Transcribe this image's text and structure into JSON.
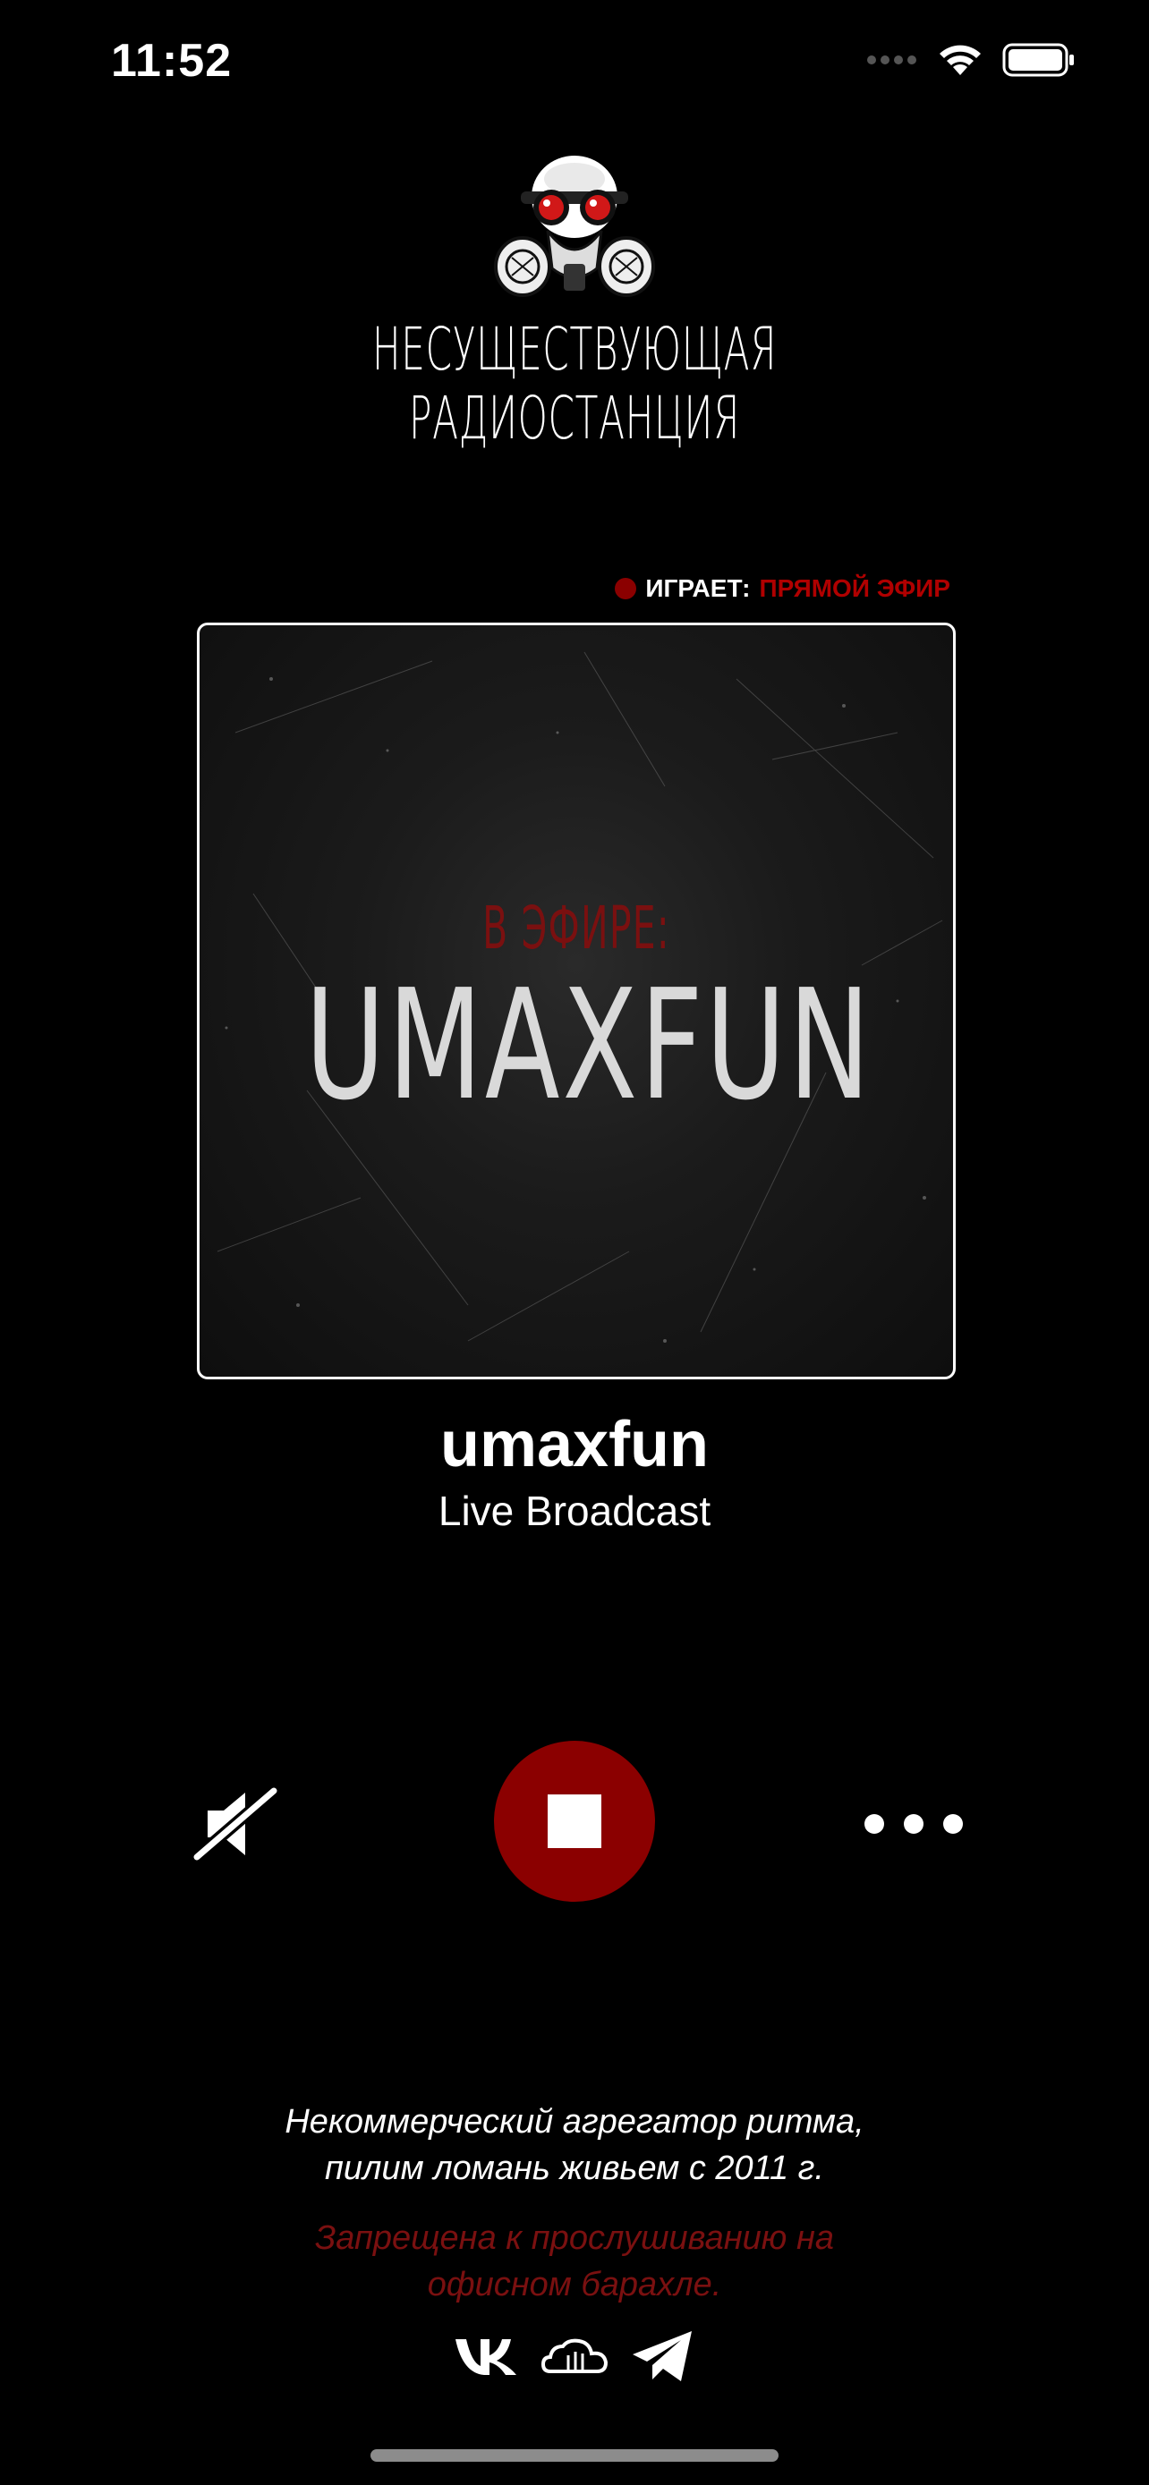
{
  "status_bar": {
    "time": "11:52"
  },
  "header": {
    "station_name": "НЕСУЩЕСТВУЮЩАЯ РАДИОСТАНЦИЯ",
    "logo_icon": "gas-mask-skull-icon"
  },
  "now_playing": {
    "label": "ИГРАЕТ:",
    "value": "ПРЯМОЙ ЭФИР",
    "indicator_color": "#8b0000"
  },
  "artwork": {
    "on_air_text": "В ЭФИРЕ:",
    "dj_text": "UMAXFUN"
  },
  "track": {
    "title": "umaxfun",
    "subtitle": "Live Broadcast"
  },
  "controls": {
    "mute_icon": "speaker-muted-icon",
    "stop_icon": "stop-icon",
    "more_icon": "more-dots-icon",
    "accent_color": "#8b0000"
  },
  "footer": {
    "line1": "Некоммерческий агрегатор ритма,",
    "line2": "пилим ломань живьем с 2011 г.",
    "warning1": "Запрещена к прослушиванию на",
    "warning2": "офисном барахле.",
    "social_icons": [
      "vk-icon",
      "soundcloud-icon",
      "telegram-icon"
    ]
  }
}
